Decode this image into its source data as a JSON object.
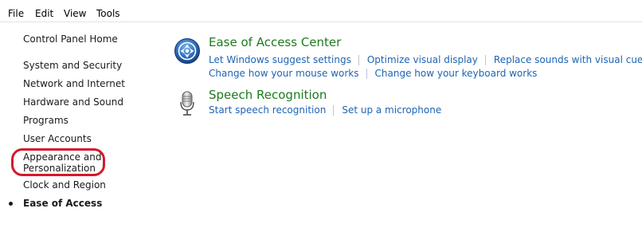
{
  "menu": {
    "file": "File",
    "edit": "Edit",
    "view": "View",
    "tools": "Tools"
  },
  "sidebar": {
    "home": "Control Panel Home",
    "items": [
      {
        "label": "System and Security"
      },
      {
        "label": "Network and Internet"
      },
      {
        "label": "Hardware and Sound"
      },
      {
        "label": "Programs"
      },
      {
        "label": "User Accounts"
      },
      {
        "label": "Appearance and Personalization"
      },
      {
        "label": "Clock and Region"
      },
      {
        "label": "Ease of Access"
      }
    ]
  },
  "sections": {
    "ease_of_access": {
      "title": "Ease of Access Center",
      "icon": "ease-of-access-icon",
      "links_row1": [
        "Let Windows suggest settings",
        "Optimize visual display",
        "Replace sounds with visual cues"
      ],
      "links_row2": [
        "Change how your mouse works",
        "Change how your keyboard works"
      ]
    },
    "speech": {
      "title": "Speech Recognition",
      "icon": "microphone-icon",
      "links": [
        "Start speech recognition",
        "Set up a microphone"
      ]
    }
  },
  "colors": {
    "link": "#1e64b4",
    "title": "#1e7a1e",
    "highlight": "#d4192b"
  }
}
